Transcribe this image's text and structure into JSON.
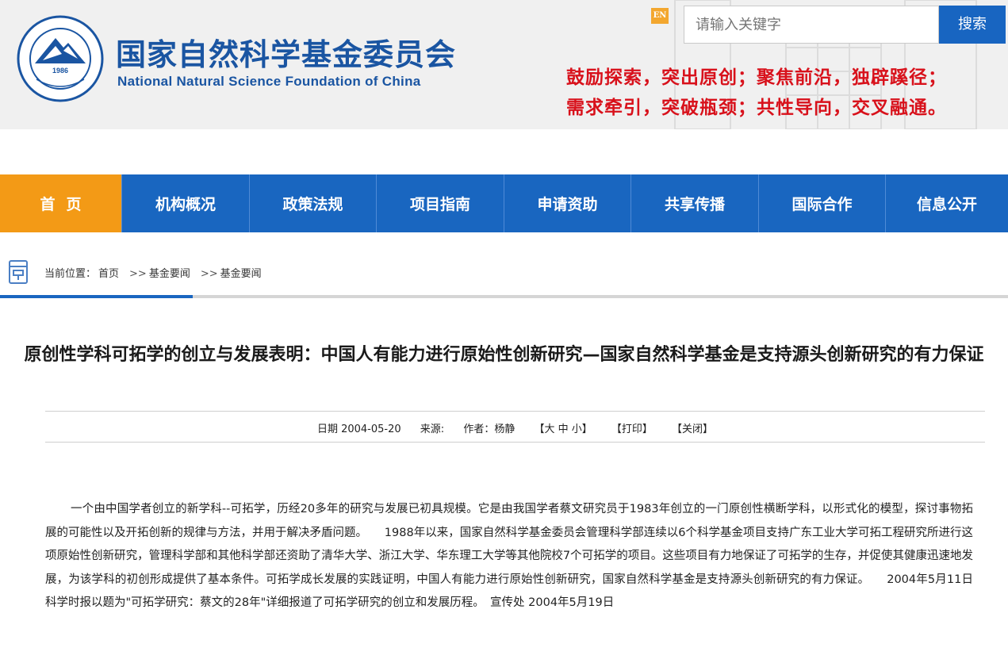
{
  "header": {
    "org_name_cn": "国家自然科学基金委员会",
    "org_name_en": "National Natural Science Foundation of China",
    "emblem_year": "1986",
    "lang_switch": "EN",
    "search_placeholder": "请输入关键字",
    "search_button": "搜索",
    "slogan_line1": "鼓励探索，突出原创；聚焦前沿，独辟蹊径；",
    "slogan_line2": "需求牵引，突破瓶颈；共性导向，交叉融通。"
  },
  "nav": {
    "items": [
      {
        "label": "首页",
        "active": true
      },
      {
        "label": "机构概况"
      },
      {
        "label": "政策法规"
      },
      {
        "label": "项目指南"
      },
      {
        "label": "申请资助"
      },
      {
        "label": "共享传播"
      },
      {
        "label": "国际合作"
      },
      {
        "label": "信息公开"
      }
    ]
  },
  "breadcrumb": {
    "prefix": "当前位置：",
    "home": "首页",
    "separator": ">>",
    "level1": "基金要闻",
    "level2": "基金要闻"
  },
  "article": {
    "title": "原创性学科可拓学的创立与发展表明：中国人有能力进行原始性创新研究—国家自然科学基金是支持源头创新研究的有力保证",
    "date": "日期 2004-05-20",
    "source": "来源:",
    "author": "作者：杨静",
    "font_size": "【大 中 小】",
    "print": "【打印】",
    "close": "【关闭】",
    "body": "一个由中国学者创立的新学科--可拓学，历经20多年的研究与发展已初具规模。它是由我国学者蔡文研究员于1983年创立的一门原创性横断学科，以形式化的模型，探讨事物拓展的可能性以及开拓创新的规律与方法，并用于解决矛盾问题。　　1988年以来，国家自然科学基金委员会管理科学部连续以6个科学基金项目支持广东工业大学可拓工程研究所进行这项原始性创新研究，管理科学部和其他科学部还资助了清华大学、浙江大学、华东理工大学等其他院校7个可拓学的项目。这些项目有力地保证了可拓学的生存，并促使其健康迅速地发展，为该学科的初创形成提供了基本条件。可拓学成长发展的实践证明，中国人有能力进行原始性创新研究，国家自然科学基金是支持源头创新研究的有力保证。　　2004年5月11日科学时报以题为\"可拓学研究：蔡文的28年\"详细报道了可拓学研究的创立和发展历程。　宣传处 2004年5月19日"
  },
  "colors": {
    "brand_blue": "#1966c0",
    "nav_active": "#f39a16",
    "slogan_red": "#d8111b"
  }
}
